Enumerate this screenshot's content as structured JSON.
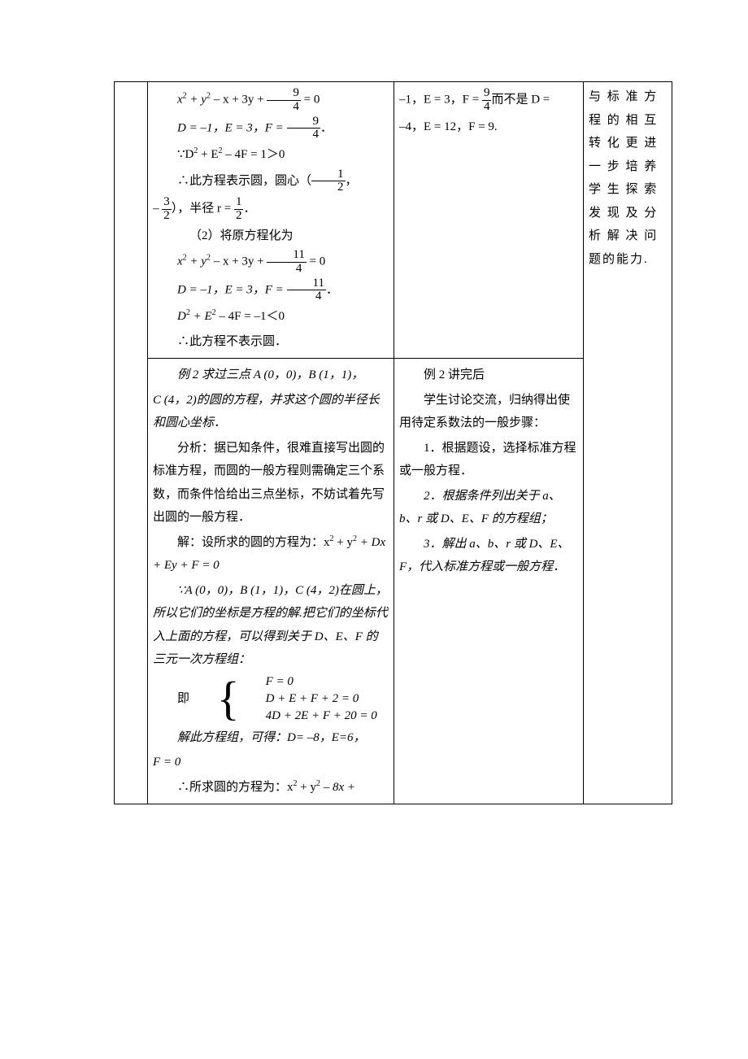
{
  "row1": {
    "col1": {
      "eq1_a": "x",
      "eq1_b": "2",
      "eq1_c": " + y",
      "eq1_d": "2",
      "eq1_e": " – x + 3y + ",
      "frac1_num": "9",
      "frac1_den": "4",
      "eq1_f": " = 0",
      "line2_a": "D = –1，E = 3，F = ",
      "frac2_num": "9",
      "frac2_den": "4",
      "line2_b": "．",
      "line3": "∵D",
      "line3b": "2",
      "line3c": " + E",
      "line3d": "2",
      "line3e": " – 4F = 1＞0",
      "line4_a": "∴此方程表示圆，圆心（",
      "frac4_num": "1",
      "frac4_den": "2",
      "line4_b": "，",
      "line5_a": "– ",
      "frac5_num": "3",
      "frac5_den": "2",
      "line5_b": "），半径 r = ",
      "frac5c_num": "1",
      "frac5c_den": "2",
      "line5_c": "．",
      "line6": "（2）将原方程化为",
      "eq7_a": "x",
      "eq7_b": "2",
      "eq7_c": " + y",
      "eq7_d": "2",
      "eq7_e": " – x + 3y + ",
      "frac7_num": "11",
      "frac7_den": "4",
      "eq7_f": " = 0",
      "line8_a": "D = –1，E = 3，F = ",
      "frac8_num": "11",
      "frac8_den": "4",
      "line8_b": "．",
      "line9_a": "D",
      "line9_b": "2",
      "line9_c": " + E",
      "line9_d": "2",
      "line9_e": " – 4F = –1＜0",
      "line10": "∴此方程不表示圆．"
    },
    "col2": {
      "l1_a": "–1，E = 3，F = ",
      "frac_num": "9",
      "frac_den": "4",
      "l1_b": "而不是 D =",
      "l2": "–4，E = 12，F = 9."
    },
    "col3": {
      "text": "与 标 准 方程 的 相 互转 化 更 进一 步 培 养学 生 探 索发 现 及 分析 解 决 问题的能力."
    }
  },
  "row2": {
    "col1": {
      "p1_a": "例 2  求过三点 A (0，0)，B (1，1)，",
      "p1_b": "C (4，2)的圆的方程，并求这个圆的半径长和圆心坐标．",
      "p2": "分析：据已知条件，很难直接写出圆的标准方程，而圆的一般方程则需确定三个系数，而条件恰给出三点坐标，不妨试着先写出圆的一般方程．",
      "p3_a": "解：设所求的圆的方程为：x",
      "p3_b": "2",
      "p3_c": " + y",
      "p3_d": "2",
      "p3_e": " + Dx + Ey + F = 0",
      "p4": "∵A (0，0)，B (1，1)，C (4，2)在圆上，所以它们的坐标是方程的解.把它们的坐标代入上面的方程，可以得到关于 D、E、F 的三元一次方程组：",
      "p5_pre": "即",
      "sys1": "F = 0",
      "sys2": "D + E + F + 2 = 0",
      "sys3": "4D + 2E + F + 20 = 0",
      "p6": "解此方程组，可得：D= –8，E=6，",
      "p6b": "F = 0",
      "p7_a": "∴所求圆的方程为：x",
      "p7_b": "2",
      "p7_c": " + y",
      "p7_d": "2",
      "p7_e": " – 8x +"
    },
    "col2": {
      "l1": "例 2 讲完后",
      "l2": "学生讨论交流，归纳得出使用待定系数法的一般步骤：",
      "l3": "1．根据题设，选择标准方程或一般方程．",
      "l4": "2．根据条件列出关于 a、b、r 或 D、E、F 的方程组；",
      "l5": "3．解出 a、b、r 或 D、E、F，代入标准方程或一般方程．"
    }
  }
}
